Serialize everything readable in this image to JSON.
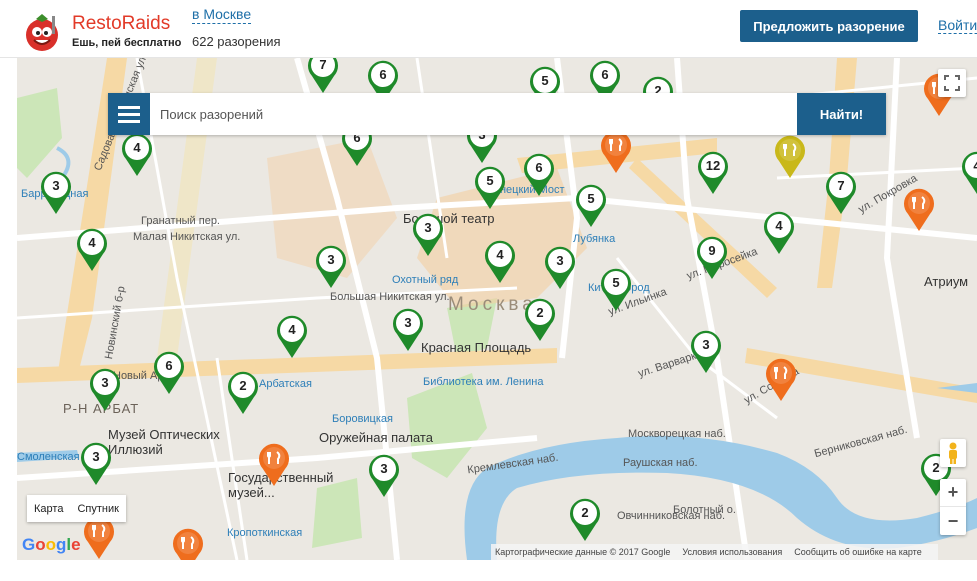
{
  "header": {
    "logo_title": "RestoRaids",
    "logo_subtitle": "Ешь, пей бесплатно",
    "city_link": "в Москве",
    "count": "622 разорения",
    "propose_button": "Предложить разорение",
    "login_link": "Войти"
  },
  "search": {
    "placeholder": "Поиск разорений",
    "find_button": "Найти!"
  },
  "map": {
    "city_label": "Москва",
    "district_labels": [
      "Р-Н АРБАТ"
    ],
    "poi_labels": [
      "Большой театр",
      "Красная Площадь",
      "Музей Оптических Иллюзий",
      "Оружейная палата",
      "Государственный музей...",
      "Атриум"
    ],
    "metro_labels": [
      "Кузнецкий Мост",
      "Лубянка",
      "Охотный ряд",
      "Китай-город",
      "Библиотека им. Ленина",
      "Боровицкая",
      "Арбатская",
      "Смоленская",
      "Кропоткинская",
      "Баррикадная"
    ],
    "street_labels": [
      "Садовая-Кудринская ул.",
      "Малая Никитская ул.",
      "Большая Никитская ул.",
      "Гранатный пер.",
      "Новинский б-р",
      "Новый Арбат",
      "ул. Варварка",
      "ул. Ильинка",
      "ул. Маросейка",
      "Москворецкая наб.",
      "Раушская наб.",
      "Кремлевская наб.",
      "Берниковская наб.",
      "Овчинниковская наб.",
      "ул. Солянка",
      "ул. Покровка",
      "Болотный о."
    ],
    "map_type": [
      "Карта",
      "Спутник"
    ],
    "google": "Google",
    "attribution": [
      "Картографические данные © 2017 Google",
      "Условия использования",
      "Сообщить об ошибке на карте"
    ],
    "zoom_in": "+",
    "zoom_out": "−",
    "markers": [
      {
        "n": "7",
        "kind": "green"
      },
      {
        "n": "6",
        "kind": "green"
      },
      {
        "n": "5",
        "kind": "green"
      },
      {
        "n": "6",
        "kind": "green"
      },
      {
        "n": "2",
        "kind": "green"
      },
      {
        "n": "4",
        "kind": "green"
      },
      {
        "n": "6",
        "kind": "green"
      },
      {
        "n": "3",
        "kind": "green"
      },
      {
        "n": "5",
        "kind": "green"
      },
      {
        "n": "6",
        "kind": "green"
      },
      {
        "n": "12",
        "kind": "green"
      },
      {
        "n": "7",
        "kind": "green"
      },
      {
        "n": "4",
        "kind": "green"
      },
      {
        "n": "5",
        "kind": "green"
      },
      {
        "n": "3",
        "kind": "green"
      },
      {
        "n": "4",
        "kind": "green"
      },
      {
        "n": "3",
        "kind": "green"
      },
      {
        "n": "4",
        "kind": "green"
      },
      {
        "n": "3",
        "kind": "green"
      },
      {
        "n": "5",
        "kind": "green"
      },
      {
        "n": "9",
        "kind": "green"
      },
      {
        "n": "4",
        "kind": "green"
      },
      {
        "n": "4",
        "kind": "green"
      },
      {
        "n": "3",
        "kind": "green"
      },
      {
        "n": "2",
        "kind": "green"
      },
      {
        "n": "3",
        "kind": "green"
      },
      {
        "n": "3",
        "kind": "green"
      },
      {
        "n": "6",
        "kind": "green"
      },
      {
        "n": "2",
        "kind": "green"
      },
      {
        "n": "3",
        "kind": "green"
      },
      {
        "n": "3",
        "kind": "green"
      },
      {
        "n": "3",
        "kind": "green"
      },
      {
        "n": "2",
        "kind": "green"
      },
      {
        "n": "2",
        "kind": "green"
      },
      {
        "n": "",
        "kind": "orange"
      },
      {
        "n": "",
        "kind": "orange"
      },
      {
        "n": "",
        "kind": "orange"
      },
      {
        "n": "",
        "kind": "orange"
      },
      {
        "n": "",
        "kind": "orange"
      },
      {
        "n": "",
        "kind": "orange"
      },
      {
        "n": "",
        "kind": "orange"
      },
      {
        "n": "",
        "kind": "yellow"
      }
    ]
  }
}
